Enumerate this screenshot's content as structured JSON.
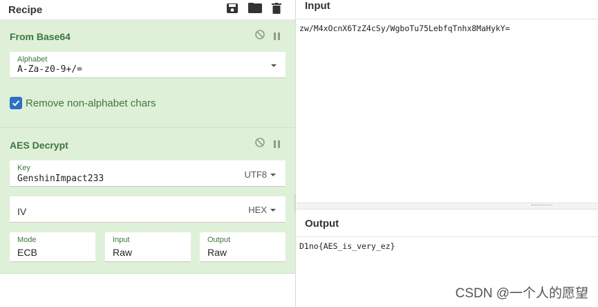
{
  "recipe": {
    "title": "Recipe",
    "operations": [
      {
        "name": "From Base64",
        "alphabet_label": "Alphabet",
        "alphabet_value": "A-Za-z0-9+/=",
        "remove_non_alphabet_label": "Remove non-alphabet chars",
        "remove_non_alphabet_checked": true
      },
      {
        "name": "AES Decrypt",
        "key_label": "Key",
        "key_value": "GenshinImpact233",
        "key_encoding": "UTF8",
        "iv_label": "IV",
        "iv_encoding": "HEX",
        "mode_label": "Mode",
        "mode_value": "ECB",
        "input_label": "Input",
        "input_value": "Raw",
        "output_label": "Output",
        "output_value": "Raw"
      }
    ]
  },
  "input": {
    "title": "Input",
    "text": "zw/M4xOcnX6TzZ4cSy/WgboTu75LebfqTnhx8MaHykY="
  },
  "output": {
    "title": "Output",
    "text": "D1no{AES_is_very_ez}"
  },
  "watermark": "CSDN @一个人的愿望",
  "colors": {
    "operation_bg": "#dff0d8",
    "operation_text": "#3c763d",
    "checkbox": "#2a70c3"
  }
}
